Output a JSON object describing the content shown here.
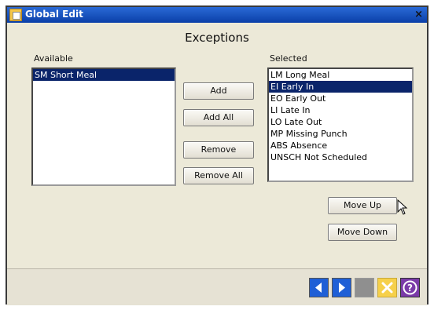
{
  "window": {
    "title": "Global Edit",
    "close_glyph": "×"
  },
  "heading": "Exceptions",
  "available": {
    "label": "Available",
    "items": [
      {
        "text": "SM Short Meal",
        "selected": true
      }
    ]
  },
  "selected": {
    "label": "Selected",
    "items": [
      {
        "text": "LM Long Meal",
        "selected": false
      },
      {
        "text": "EI Early In",
        "selected": true
      },
      {
        "text": "EO Early Out",
        "selected": false
      },
      {
        "text": "LI Late In",
        "selected": false
      },
      {
        "text": "LO Late Out",
        "selected": false
      },
      {
        "text": "MP Missing Punch",
        "selected": false
      },
      {
        "text": "ABS Absence",
        "selected": false
      },
      {
        "text": "UNSCH Not Scheduled",
        "selected": false
      }
    ]
  },
  "buttons": {
    "add": "Add",
    "add_all": "Add All",
    "remove": "Remove",
    "remove_all": "Remove All",
    "move_up": "Move Up",
    "move_down": "Move Down"
  },
  "footer": {
    "icons": [
      "back-arrow-icon",
      "forward-arrow-icon",
      "disabled-square-icon",
      "cancel-icon",
      "help-icon"
    ],
    "colors": {
      "nav_blue": "#1f5fd6",
      "disabled_gray": "#8f8f8f",
      "cancel_yellow": "#f6d04a",
      "help_purple": "#7a3aa8"
    }
  },
  "colors": {
    "selection": "#0a246a",
    "title_bar": "#0a3fa8"
  }
}
